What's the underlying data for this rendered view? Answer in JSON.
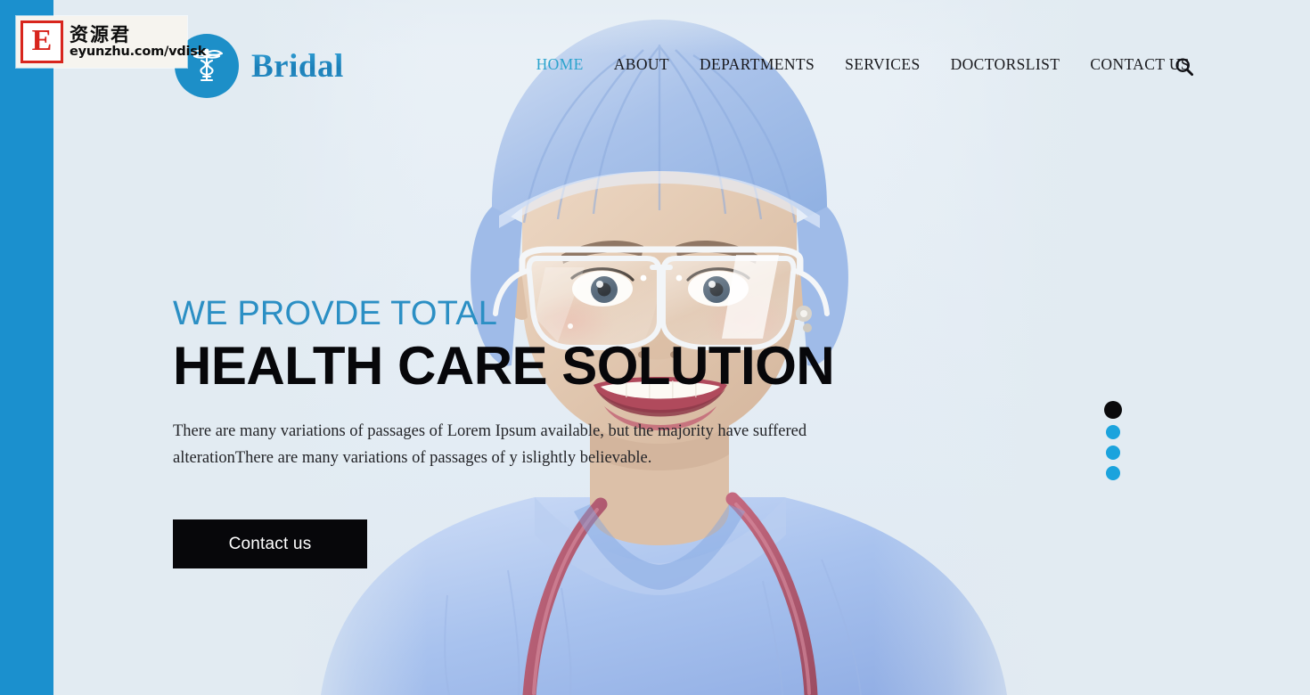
{
  "site": {
    "background_color": "#e2ebf2",
    "accent_color": "#1b90ce",
    "brand_name": "Bridal",
    "logo_icon": "caduceus-medical-icon"
  },
  "nav": {
    "items": [
      {
        "label": "HOME",
        "active": true
      },
      {
        "label": "ABOUT",
        "active": false
      },
      {
        "label": "DEPARTMENTS",
        "active": false
      },
      {
        "label": "SERVICES",
        "active": false
      },
      {
        "label": "DOCTORSLIST",
        "active": false
      },
      {
        "label": "CONTACT US",
        "active": false
      }
    ],
    "search_icon": "search-icon",
    "active_color": "#2ba3cd",
    "text_color": "#18181c"
  },
  "hero": {
    "eyebrow": "WE PROVDE TOTAL",
    "eyebrow_color": "#2b8fc4",
    "headline": "HEALTH CARE SOLUTION",
    "headline_color": "#07070a",
    "paragraph": "There are many variations of passages of Lorem Ipsum available, but the majority have suffered alterationThere are many variations of passages of y islightly believable.",
    "cta_label": "Contact us",
    "cta_background": "#07070a",
    "cta_text_color": "#ffffff",
    "photo_alt": "female-doctor-surgical-cap-glasses-stethoscope"
  },
  "slider": {
    "dots": [
      {
        "active": true,
        "color": "#0a0a0c"
      },
      {
        "active": false,
        "color": "#1ba3dd"
      },
      {
        "active": false,
        "color": "#1ba3dd"
      },
      {
        "active": false,
        "color": "#1ba3dd"
      }
    ],
    "active_index": 0,
    "total": 4
  },
  "watermark": {
    "logo_letter": "E",
    "logo_color": "#d8251d",
    "chinese_text": "资源君",
    "url": "eyunzhu.com/vdisk"
  }
}
